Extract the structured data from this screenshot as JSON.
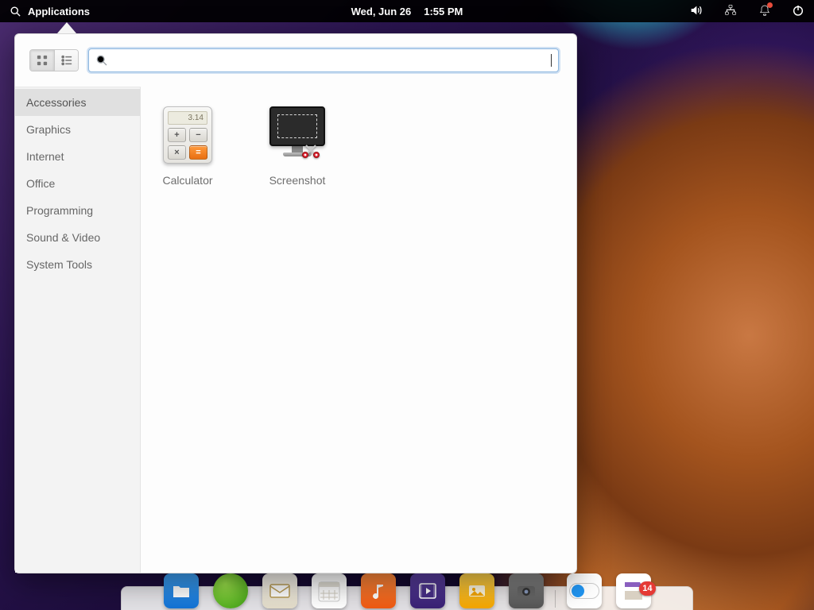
{
  "topbar": {
    "applications_label": "Applications",
    "date": "Wed, Jun 26",
    "time": "1:55 PM"
  },
  "appmenu": {
    "search_placeholder": "",
    "categories": [
      "Accessories",
      "Graphics",
      "Internet",
      "Office",
      "Programming",
      "Sound & Video",
      "System Tools"
    ],
    "apps": [
      {
        "name": "Calculator",
        "display": "3.14"
      },
      {
        "name": "Screenshot"
      }
    ]
  },
  "dock": {
    "update_badge": "14"
  }
}
